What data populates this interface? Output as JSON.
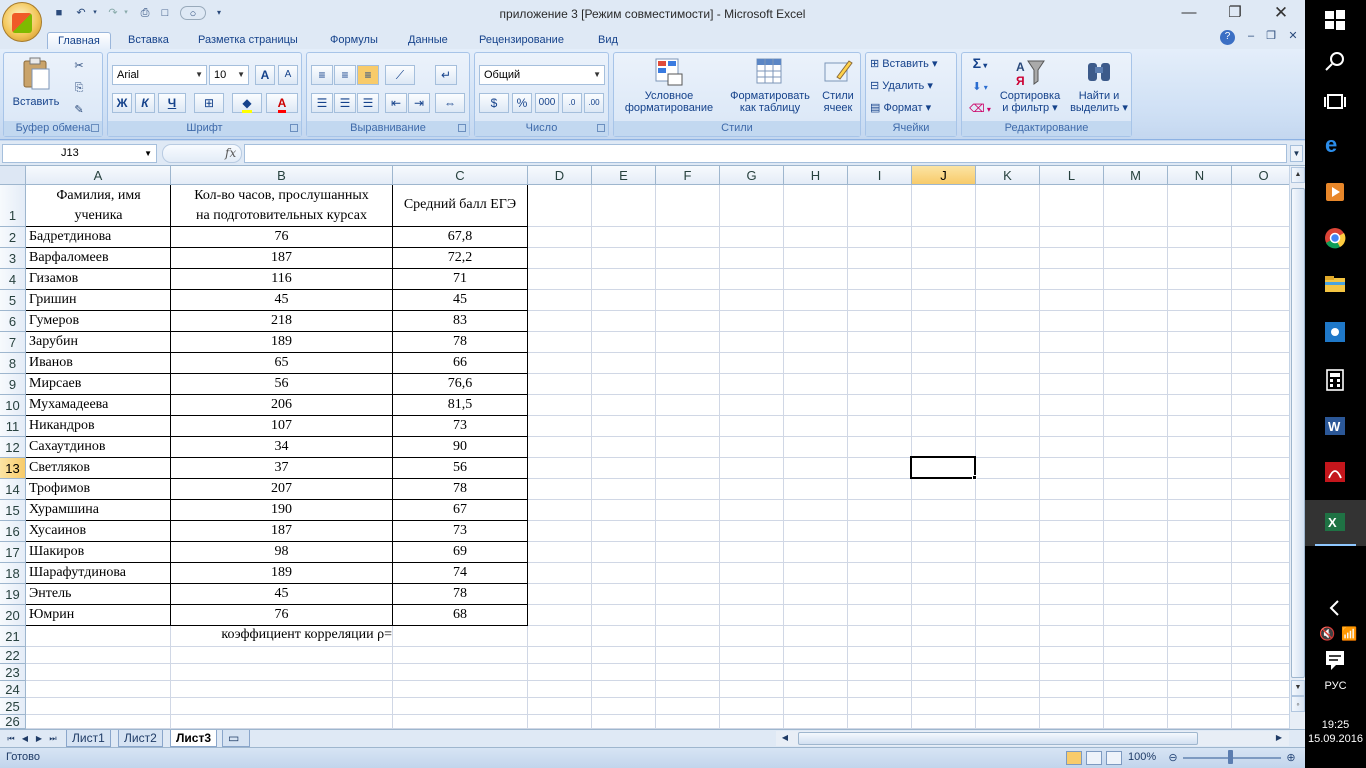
{
  "window": {
    "title": "приложение 3  [Режим совместимости] - Microsoft Excel",
    "minimize_icon": "minimize-icon",
    "maximize_icon": "restore-icon",
    "close_icon": "close-icon"
  },
  "tabs": [
    "Главная",
    "Вставка",
    "Разметка страницы",
    "Формулы",
    "Данные",
    "Рецензирование",
    "Вид"
  ],
  "ribbon": {
    "clipboard": {
      "paste": "Вставить",
      "label": "Буфер обмена"
    },
    "font": {
      "name": "Arial",
      "size": "10",
      "label": "Шрифт",
      "bold": "Ж",
      "italic": "К",
      "underline": "Ч",
      "grow": "A",
      "shrink": "A",
      "fontcolor": "A"
    },
    "alignment": {
      "label": "Выравнивание"
    },
    "number": {
      "format": "Общий",
      "label": "Число",
      "percent": "%",
      "thousands": "000"
    },
    "styles": {
      "conditional": "Условное",
      "conditional2": "форматирование",
      "astable": "Форматировать",
      "astable2": "как таблицу",
      "cellstyles": "Стили",
      "cellstyles2": "ячеек",
      "label": "Стили"
    },
    "cells": {
      "insert": "Вставить",
      "delete": "Удалить",
      "format": "Формат",
      "label": "Ячейки"
    },
    "editing": {
      "sigma": "Σ",
      "sort": "Сортировка",
      "sort2": "и фильтр",
      "find": "Найти и",
      "find2": "выделить",
      "label": "Редактирование"
    }
  },
  "formula_bar": {
    "name_box": "J13",
    "fx": "fx",
    "formula": ""
  },
  "columns": [
    "A",
    "B",
    "C",
    "D",
    "E",
    "F",
    "G",
    "H",
    "I",
    "J",
    "K",
    "L",
    "M",
    "N",
    "O"
  ],
  "rows": [
    "1",
    "2",
    "3",
    "4",
    "5",
    "6",
    "7",
    "8",
    "9",
    "10",
    "11",
    "12",
    "13",
    "14",
    "15",
    "16",
    "17",
    "18",
    "19",
    "20",
    "21",
    "22",
    "23",
    "24",
    "25",
    "26"
  ],
  "selected": {
    "column": "J",
    "row": "13"
  },
  "table": {
    "header": {
      "a1_line1": "Фамилия, имя",
      "a1_line2": "ученика",
      "b1_line1": "Кол-во часов, прослушанных",
      "b1_line2": "на подготовительных курсах",
      "c1": "Средний балл ЕГЭ"
    },
    "rows": [
      {
        "name": "Бадретдинова",
        "hours": "76",
        "score": "67,8"
      },
      {
        "name": "Варфаломеев",
        "hours": "187",
        "score": "72,2"
      },
      {
        "name": "Гизамов",
        "hours": "116",
        "score": "71"
      },
      {
        "name": "Гришин",
        "hours": "45",
        "score": "45"
      },
      {
        "name": "Гумеров",
        "hours": "218",
        "score": "83"
      },
      {
        "name": "Зарубин",
        "hours": "189",
        "score": "78"
      },
      {
        "name": "Иванов",
        "hours": "65",
        "score": "66"
      },
      {
        "name": "Мирсаев",
        "hours": "56",
        "score": "76,6"
      },
      {
        "name": "Мухамадеева",
        "hours": "206",
        "score": "81,5"
      },
      {
        "name": "Никандров",
        "hours": "107",
        "score": "73"
      },
      {
        "name": "Сахаутдинов",
        "hours": "34",
        "score": "90"
      },
      {
        "name": "Светляков",
        "hours": "37",
        "score": "56"
      },
      {
        "name": "Трофимов",
        "hours": "207",
        "score": "78"
      },
      {
        "name": "Хурамшина",
        "hours": "190",
        "score": "67"
      },
      {
        "name": "Хусаинов",
        "hours": "187",
        "score": "73"
      },
      {
        "name": "Шакиров",
        "hours": "98",
        "score": "69"
      },
      {
        "name": "Шарафутдинова",
        "hours": "189",
        "score": "74"
      },
      {
        "name": "Энтель",
        "hours": "45",
        "score": "78"
      },
      {
        "name": "Юмрин",
        "hours": "76",
        "score": "68"
      }
    ],
    "correlation_label": "коэффициент корреляции ρ="
  },
  "sheets": [
    "Лист1",
    "Лист2",
    "Лист3"
  ],
  "active_sheet": "Лист3",
  "status": {
    "ready": "Готово",
    "zoom": "100%"
  },
  "taskbar": {
    "lang": "РУС",
    "time": "19:25",
    "date": "15.09.2016"
  },
  "colors": {
    "accent": "#c5d7ee",
    "selected_header": "#f8cb6a",
    "excel_green": "#1f7244"
  }
}
